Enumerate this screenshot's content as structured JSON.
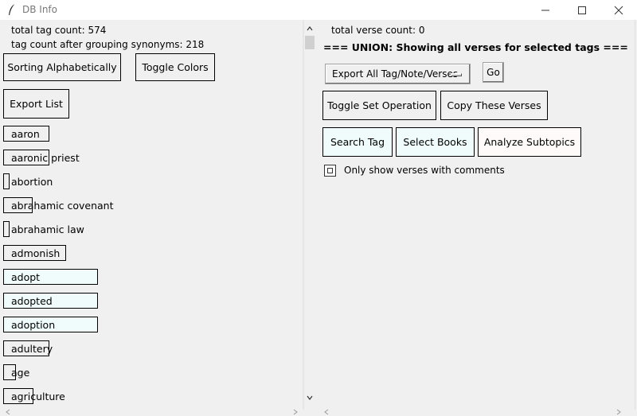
{
  "window": {
    "title": "DB Info"
  },
  "left": {
    "total_tag_count": "total tag count: 574",
    "grouped_count": "tag count after grouping synonyms: 218",
    "buttons": {
      "sort": "Sorting Alphabetically",
      "toggle_colors": "Toggle Colors",
      "export_list": "Export List"
    },
    "tags": [
      {
        "label": "aaron"
      },
      {
        "label": "aaronic priest"
      },
      {
        "label": "abortion"
      },
      {
        "label": "abrahamic covenant"
      },
      {
        "label": "abrahamic law"
      },
      {
        "label": "admonish"
      },
      {
        "label": "adopt"
      },
      {
        "label": "adopted"
      },
      {
        "label": "adoption"
      },
      {
        "label": "adultery"
      },
      {
        "label": "age"
      },
      {
        "label": "agriculture"
      }
    ]
  },
  "right": {
    "verse_count": "total verse count: 0",
    "union_heading": "=== UNION: Showing all verses for selected tags ===",
    "export_menu": "Export All Tag/Note/Verses",
    "go": "Go",
    "buttons": {
      "toggle_set": "Toggle Set Operation",
      "copy_verses": "Copy These Verses",
      "search_tag": "Search Tag",
      "select_books": "Select Books",
      "analyze_subtopics": "Analyze Subtopics"
    },
    "checkbox_label": "Only show verses with comments"
  },
  "colors": {
    "cyan_tint": "#f0fcfc",
    "pink_tint": "#fffafa"
  }
}
